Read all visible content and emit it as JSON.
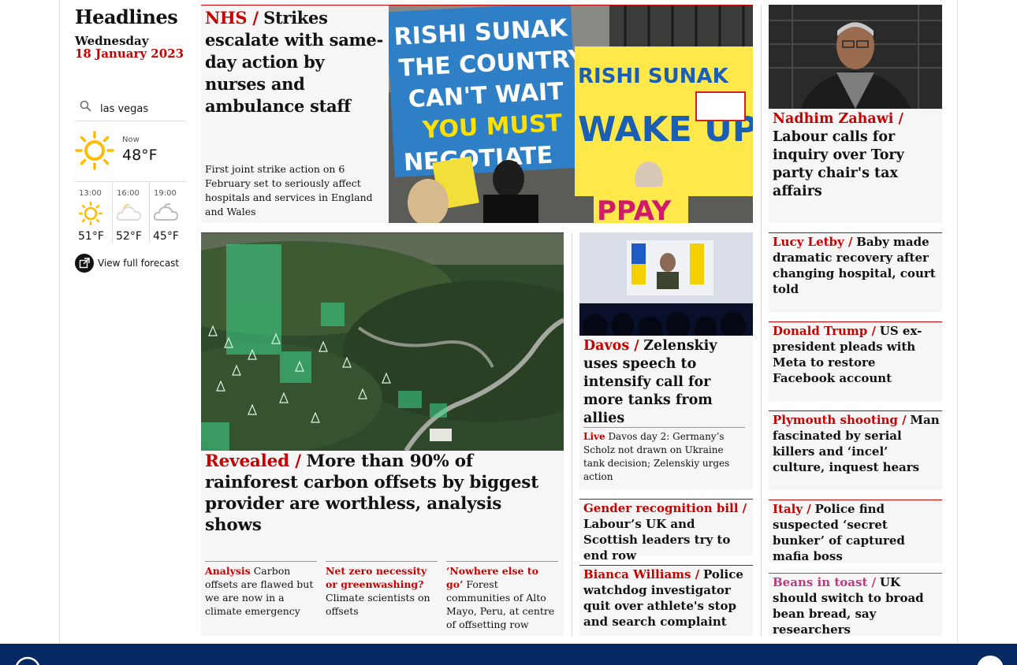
{
  "left": {
    "title": "Headlines",
    "date_day": "Wednesday",
    "date_full": "18 January 2023",
    "weather": {
      "location": "las vegas",
      "now_label": "Now",
      "now_temp": "48°F",
      "hours": [
        {
          "time": "13:00",
          "temp": "51°F",
          "icon": "sun-icon"
        },
        {
          "time": "16:00",
          "temp": "52°F",
          "icon": "cloud-icon"
        },
        {
          "time": "19:00",
          "temp": "45°F",
          "icon": "cloud-icon"
        }
      ],
      "forecast_link": "View full forecast"
    }
  },
  "nhs": {
    "kicker": "NHS /",
    "headline": "Strikes escalate with same-day action by nurses and ambulance staff",
    "standfirst": "First joint strike action on 6 February set to seriously affect hospitals and services in England and Wales",
    "placards": [
      "RISHI SUNAK",
      "THE COUNTRY",
      "CAN'T WAIT",
      "YOU MUST",
      "NEGOTIATE",
      "RISHI SUNAK",
      "WAKE UP"
    ]
  },
  "zahawi": {
    "kicker": "Nadhim Zahawi /",
    "headline": "Labour calls for inquiry over Tory party chair's tax affairs"
  },
  "rainforest": {
    "kicker": "Revealed /",
    "headline": "More than 90% of rainforest carbon offsets by biggest provider are worthless, analysis shows",
    "sublinks": [
      {
        "kicker": "Analysis",
        "text": "Carbon offsets are flawed but we are now in a climate emergency"
      },
      {
        "kicker": "Net zero necessity or greenwashing?",
        "text": "Climate scientists on offsets"
      },
      {
        "kicker": "‘Nowhere else to go’",
        "text": "Forest communities of Alto Mayo, Peru, at centre of offsetting row"
      }
    ]
  },
  "davos": {
    "kicker": "Davos /",
    "headline": "Zelenskiy uses speech to intensify call for more tanks from allies",
    "live_kicker": "Live",
    "live_text": "Davos day 2: Germany’s Scholz not drawn on Ukraine tank decision; Zelenskiy urges action"
  },
  "middle_small": [
    {
      "kicker": "Gender recognition bill /",
      "headline": "Labour’s UK and Scottish leaders try to end row"
    },
    {
      "kicker": "Bianca Williams /",
      "headline": "Police watchdog investigator quit over athlete's stop and search complaint"
    }
  ],
  "right_small": [
    {
      "kicker": "Lucy Letby /",
      "headline": "Baby made dramatic recovery after changing hospital, court told",
      "pink": false
    },
    {
      "kicker": "Donald Trump /",
      "headline": "US ex-president pleads with Meta to restore Facebook account",
      "pink": false
    },
    {
      "kicker": "Plymouth shooting /",
      "headline": "Man fascinated by serial killers and ‘incel’ culture, inquest hears",
      "pink": false
    },
    {
      "kicker": "Italy /",
      "headline": "Police find suspected ‘secret bunker’ of captured mafia boss",
      "pink": false
    },
    {
      "kicker": "Beans in toast /",
      "headline": "UK should switch to broad bean bread, say researchers",
      "pink": true
    }
  ],
  "colors": {
    "news_red": "#c70000",
    "lifestyle_pink": "#bb3b80",
    "brand_blue": "#052962",
    "card_bg": "#f6f6f6"
  }
}
